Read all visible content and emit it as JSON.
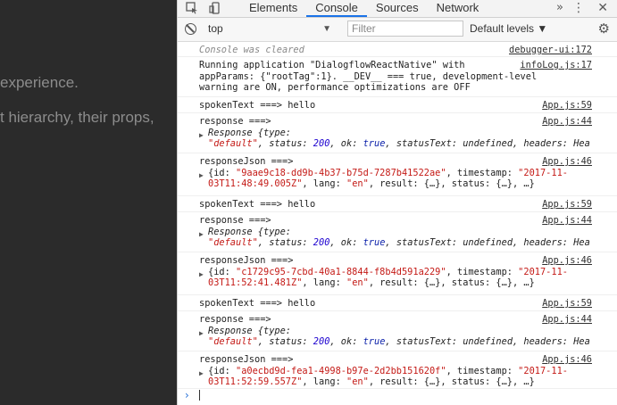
{
  "left_panel": {
    "line1": "experience.",
    "line2": "t hierarchy, their props,"
  },
  "devtools": {
    "tabs": [
      "Elements",
      "Console",
      "Sources",
      "Network"
    ],
    "active_tab": "Console",
    "more_label": "»",
    "context_value": "top",
    "filter_placeholder": "Filter",
    "levels_label": "Default levels ▼"
  },
  "console": {
    "cleared_text": "Console was cleared",
    "cleared_source": "debugger-ui:172",
    "running_text_1": "Running application \"DialogflowReactNative\" with",
    "running_text_2": "appParams: {\"rootTag\":1}. __DEV__ === true, development-level",
    "running_text_3": "warning are ON, performance optimizations are OFF",
    "running_source": "infoLog.js:17",
    "spoken_text": "spokenText ===> hello",
    "spoken_source": "App.js:59",
    "response_label": "response ===>",
    "response_source": "App.js:44",
    "response_obj_1": "Response {type:",
    "response_type": "\"default\"",
    "response_status": "200",
    "response_ok": "true",
    "response_tail": "statusText: undefined, headers: Hea",
    "response_json_label": "responseJson ===>",
    "response_json_source": "App.js:46",
    "json_1_id": "\"9aae9c18-dd9b-4b37-b75d-7287b41522ae\"",
    "json_1_ts_a": "\"2017-11-",
    "json_1_ts_b": "03T11:48:49.005Z\"",
    "json_2_id": "\"c1729c95-7cbd-40a1-8844-f8b4d591a229\"",
    "json_2_ts_a": "\"2017-11-",
    "json_2_ts_b": "03T11:52:41.481Z\"",
    "json_3_id": "\"a0ecbd9d-fea1-4998-b97e-2d2bb151620f\"",
    "json_3_ts_a": "\"2017-11-",
    "json_3_ts_b": "03T11:52:59.557Z\"",
    "json_lang": "\"en\"",
    "prompt": "›"
  }
}
